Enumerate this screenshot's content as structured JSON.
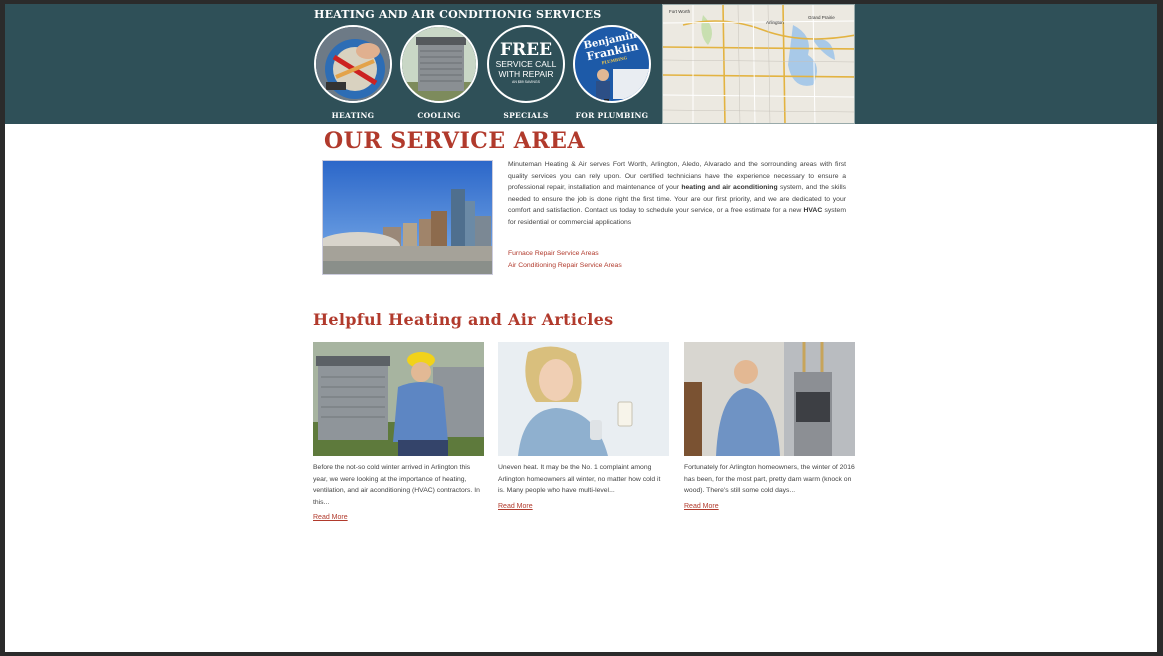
{
  "header": {
    "title": "HEATING AND AIR CONDITIONIG SERVICES",
    "services": [
      {
        "label": "HEATING",
        "icon": "heating-photo"
      },
      {
        "label": "COOLING",
        "icon": "ac-unit-photo"
      },
      {
        "label": "SPECIALS",
        "icon": "free-service-badge",
        "badge_big": "FREE",
        "badge_line1": "SERVICE CALL",
        "badge_line2": "WITH REPAIR",
        "badge_small": "AN $89 SAVINGS"
      },
      {
        "label": "FOR PLUMBING",
        "icon": "benjamin-franklin-logo",
        "logo_line1": "Benjamin",
        "logo_line2": "Franklin",
        "logo_line3": "PLUMBING"
      }
    ],
    "map": {
      "label_fort_worth": "Fort Worth",
      "label_arlington": "Arlington",
      "label_grand_prairie": "Grand Prairie"
    }
  },
  "service_area": {
    "title": "OUR SERVICE AREA",
    "intro_part1": "Minuteman Heating & Air serves Fort Worth, Arlington, Aledo, Alvarado and the sorrounding areas with first quality services you can rely upon. Our certified technicians have the experience necessary to ensure a professional repair, installation and maintenance of your ",
    "intro_bold1": "heating and air aconditioning",
    "intro_part2": " system, and the skills needed to ensure the job is done right the first time. Your are our first priority, and we are dedicated to your comfort and satisfaction. Contact us today to schedule your service, or a free estimate for a new ",
    "intro_bold2": "HVAC",
    "intro_part3": " system for residential or commercial applications",
    "links": [
      "Furnace Repair Service Areas",
      "Air Conditioning Repair Service Areas"
    ]
  },
  "articles": {
    "title": "Helpful Heating and Air Articles",
    "items": [
      {
        "text": "Before the not-so cold winter arrived in Arlington this year, we were looking at the importance of heating, ventilation, and air aconditioning (HVAC) contractors. In this...",
        "more": "Read More"
      },
      {
        "text": "Uneven heat. It may be the No. 1 complaint among Arlington homeowners all winter, no matter how cold it is. Many people who have multi-level...",
        "more": "Read More"
      },
      {
        "text": "Fortunately for Arlington homeowners, the winter of 2016 has been, for the most part, pretty darn warm (knock on wood). There's still some cold days...",
        "more": "Read More"
      }
    ]
  },
  "colors": {
    "header_band": "#2f5058",
    "accent": "#b13a2c"
  }
}
